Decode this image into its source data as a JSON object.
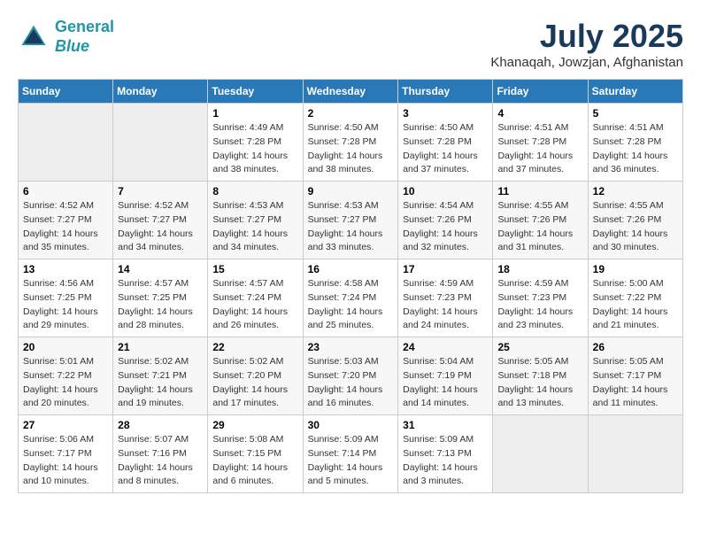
{
  "header": {
    "logo_line1": "General",
    "logo_line2": "Blue",
    "month": "July 2025",
    "location": "Khanaqah, Jowzjan, Afghanistan"
  },
  "days_of_week": [
    "Sunday",
    "Monday",
    "Tuesday",
    "Wednesday",
    "Thursday",
    "Friday",
    "Saturday"
  ],
  "weeks": [
    [
      {
        "num": "",
        "info": ""
      },
      {
        "num": "",
        "info": ""
      },
      {
        "num": "1",
        "info": "Sunrise: 4:49 AM\nSunset: 7:28 PM\nDaylight: 14 hours\nand 38 minutes."
      },
      {
        "num": "2",
        "info": "Sunrise: 4:50 AM\nSunset: 7:28 PM\nDaylight: 14 hours\nand 38 minutes."
      },
      {
        "num": "3",
        "info": "Sunrise: 4:50 AM\nSunset: 7:28 PM\nDaylight: 14 hours\nand 37 minutes."
      },
      {
        "num": "4",
        "info": "Sunrise: 4:51 AM\nSunset: 7:28 PM\nDaylight: 14 hours\nand 37 minutes."
      },
      {
        "num": "5",
        "info": "Sunrise: 4:51 AM\nSunset: 7:28 PM\nDaylight: 14 hours\nand 36 minutes."
      }
    ],
    [
      {
        "num": "6",
        "info": "Sunrise: 4:52 AM\nSunset: 7:27 PM\nDaylight: 14 hours\nand 35 minutes."
      },
      {
        "num": "7",
        "info": "Sunrise: 4:52 AM\nSunset: 7:27 PM\nDaylight: 14 hours\nand 34 minutes."
      },
      {
        "num": "8",
        "info": "Sunrise: 4:53 AM\nSunset: 7:27 PM\nDaylight: 14 hours\nand 34 minutes."
      },
      {
        "num": "9",
        "info": "Sunrise: 4:53 AM\nSunset: 7:27 PM\nDaylight: 14 hours\nand 33 minutes."
      },
      {
        "num": "10",
        "info": "Sunrise: 4:54 AM\nSunset: 7:26 PM\nDaylight: 14 hours\nand 32 minutes."
      },
      {
        "num": "11",
        "info": "Sunrise: 4:55 AM\nSunset: 7:26 PM\nDaylight: 14 hours\nand 31 minutes."
      },
      {
        "num": "12",
        "info": "Sunrise: 4:55 AM\nSunset: 7:26 PM\nDaylight: 14 hours\nand 30 minutes."
      }
    ],
    [
      {
        "num": "13",
        "info": "Sunrise: 4:56 AM\nSunset: 7:25 PM\nDaylight: 14 hours\nand 29 minutes."
      },
      {
        "num": "14",
        "info": "Sunrise: 4:57 AM\nSunset: 7:25 PM\nDaylight: 14 hours\nand 28 minutes."
      },
      {
        "num": "15",
        "info": "Sunrise: 4:57 AM\nSunset: 7:24 PM\nDaylight: 14 hours\nand 26 minutes."
      },
      {
        "num": "16",
        "info": "Sunrise: 4:58 AM\nSunset: 7:24 PM\nDaylight: 14 hours\nand 25 minutes."
      },
      {
        "num": "17",
        "info": "Sunrise: 4:59 AM\nSunset: 7:23 PM\nDaylight: 14 hours\nand 24 minutes."
      },
      {
        "num": "18",
        "info": "Sunrise: 4:59 AM\nSunset: 7:23 PM\nDaylight: 14 hours\nand 23 minutes."
      },
      {
        "num": "19",
        "info": "Sunrise: 5:00 AM\nSunset: 7:22 PM\nDaylight: 14 hours\nand 21 minutes."
      }
    ],
    [
      {
        "num": "20",
        "info": "Sunrise: 5:01 AM\nSunset: 7:22 PM\nDaylight: 14 hours\nand 20 minutes."
      },
      {
        "num": "21",
        "info": "Sunrise: 5:02 AM\nSunset: 7:21 PM\nDaylight: 14 hours\nand 19 minutes."
      },
      {
        "num": "22",
        "info": "Sunrise: 5:02 AM\nSunset: 7:20 PM\nDaylight: 14 hours\nand 17 minutes."
      },
      {
        "num": "23",
        "info": "Sunrise: 5:03 AM\nSunset: 7:20 PM\nDaylight: 14 hours\nand 16 minutes."
      },
      {
        "num": "24",
        "info": "Sunrise: 5:04 AM\nSunset: 7:19 PM\nDaylight: 14 hours\nand 14 minutes."
      },
      {
        "num": "25",
        "info": "Sunrise: 5:05 AM\nSunset: 7:18 PM\nDaylight: 14 hours\nand 13 minutes."
      },
      {
        "num": "26",
        "info": "Sunrise: 5:05 AM\nSunset: 7:17 PM\nDaylight: 14 hours\nand 11 minutes."
      }
    ],
    [
      {
        "num": "27",
        "info": "Sunrise: 5:06 AM\nSunset: 7:17 PM\nDaylight: 14 hours\nand 10 minutes."
      },
      {
        "num": "28",
        "info": "Sunrise: 5:07 AM\nSunset: 7:16 PM\nDaylight: 14 hours\nand 8 minutes."
      },
      {
        "num": "29",
        "info": "Sunrise: 5:08 AM\nSunset: 7:15 PM\nDaylight: 14 hours\nand 6 minutes."
      },
      {
        "num": "30",
        "info": "Sunrise: 5:09 AM\nSunset: 7:14 PM\nDaylight: 14 hours\nand 5 minutes."
      },
      {
        "num": "31",
        "info": "Sunrise: 5:09 AM\nSunset: 7:13 PM\nDaylight: 14 hours\nand 3 minutes."
      },
      {
        "num": "",
        "info": ""
      },
      {
        "num": "",
        "info": ""
      }
    ]
  ]
}
